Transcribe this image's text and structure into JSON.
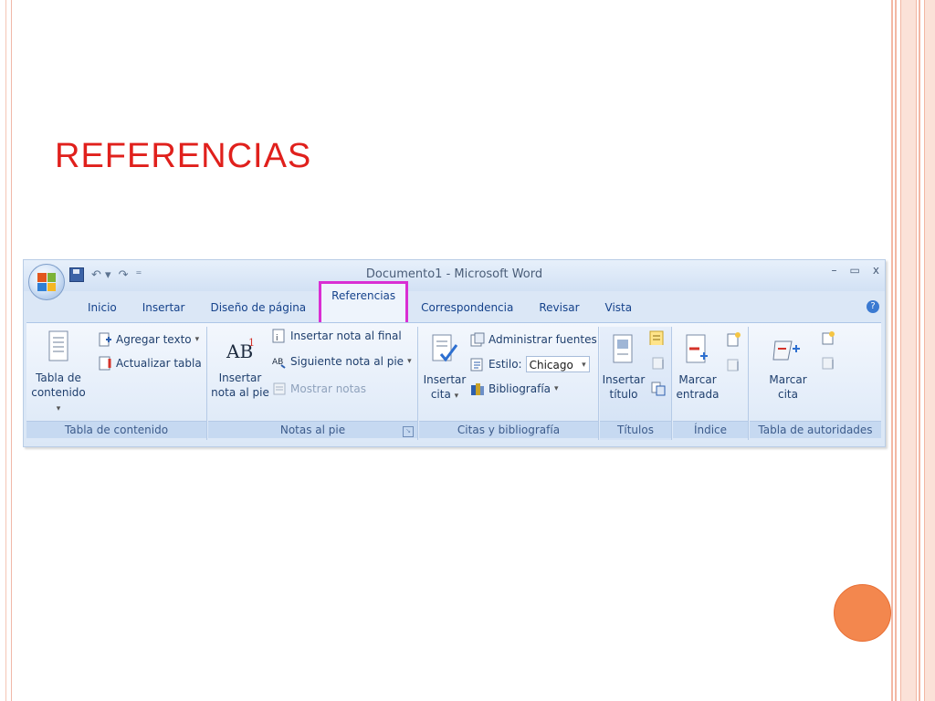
{
  "slide": {
    "title": "REFERENCIAS"
  },
  "window": {
    "title": "Documento1 - Microsoft Word",
    "controls": [
      "–",
      "▭",
      "x"
    ]
  },
  "tabs": [
    {
      "label": "Inicio",
      "active": false
    },
    {
      "label": "Insertar",
      "active": false
    },
    {
      "label": "Diseño de página",
      "active": false
    },
    {
      "label": "Referencias",
      "active": true
    },
    {
      "label": "Correspondencia",
      "active": false
    },
    {
      "label": "Revisar",
      "active": false
    },
    {
      "label": "Vista",
      "active": false
    }
  ],
  "highlight_color": "#d92ed3",
  "groups": {
    "tabla_contenido": {
      "label": "Tabla de contenido",
      "big_line1": "Tabla de",
      "big_line2": "contenido",
      "agregar_texto": "Agregar texto",
      "actualizar_tabla": "Actualizar tabla"
    },
    "notas_pie": {
      "label": "Notas al pie",
      "big_line1": "Insertar",
      "big_line2": "nota al pie",
      "insertar_final": "Insertar nota al final",
      "siguiente_nota": "Siguiente nota al pie",
      "mostrar_notas": "Mostrar notas"
    },
    "citas": {
      "label": "Citas y bibliografía",
      "big_line1": "Insertar",
      "big_line2": "cita",
      "administrar": "Administrar fuentes",
      "estilo_label": "Estilo:",
      "estilo_value": "Chicago",
      "bibliografia": "Bibliografía"
    },
    "titulos": {
      "label": "Títulos",
      "big_line1": "Insertar",
      "big_line2": "título"
    },
    "indice": {
      "label": "Índice",
      "big_line1": "Marcar",
      "big_line2": "entrada"
    },
    "autoridades": {
      "label": "Tabla de autoridades",
      "big_line1": "Marcar",
      "big_line2": "cita"
    }
  },
  "icons": {
    "office_button": "office-logo-icon",
    "save": "save-icon",
    "undo": "undo-icon",
    "redo": "redo-icon",
    "help": "help-icon"
  }
}
